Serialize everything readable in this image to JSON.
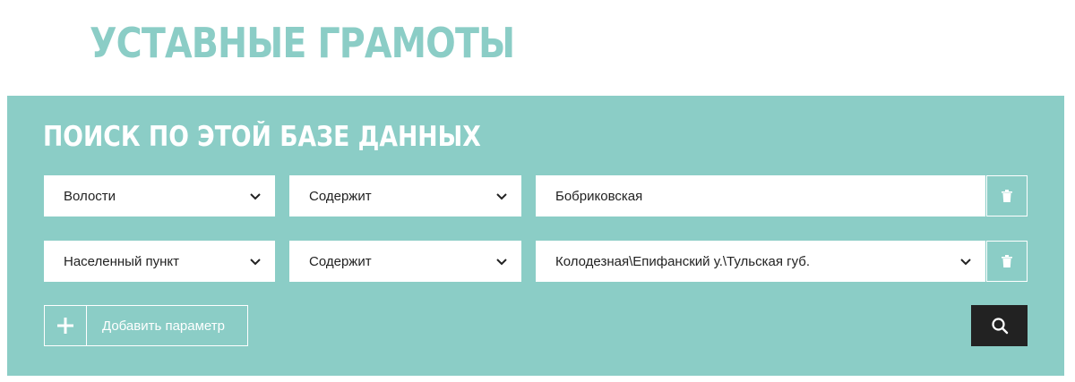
{
  "page": {
    "title": "УСТАВНЫЕ ГРАМОТЫ"
  },
  "search": {
    "title": "ПОИСК ПО ЭТОЙ БАЗЕ ДАННЫХ",
    "rows": [
      {
        "field": "Волости",
        "condition": "Содержит",
        "value": "Бобриковская",
        "value_type": "text"
      },
      {
        "field": "Населенный пункт",
        "condition": "Содержит",
        "value": "Колодезная\\Епифанский у.\\Тульская губ.",
        "value_type": "select"
      }
    ],
    "add_param_label": "Добавить параметр",
    "icons": {
      "delete": "trash-icon",
      "add": "plus-icon",
      "submit": "search-icon",
      "dropdown": "chevron-down-icon"
    }
  },
  "colors": {
    "accent": "#8bcdc6",
    "button_dark": "#222222",
    "field_bg": "#ffffff"
  }
}
